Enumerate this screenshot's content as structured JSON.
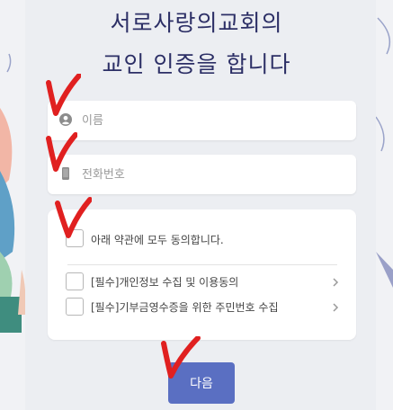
{
  "page": {
    "title_line1": "서로사랑의교회의",
    "title_line2": "교인 인증을 합니다"
  },
  "form": {
    "name": {
      "placeholder": "이름",
      "icon": "person-icon"
    },
    "phone": {
      "placeholder": "전화번호",
      "icon": "phone-icon"
    }
  },
  "agreements": {
    "all_label": "아래 약관에 모두 동의합니다.",
    "items": [
      {
        "label": "[필수]개인정보 수집 및 이용동의"
      },
      {
        "label": "[필수]기부금영수증을 위한 주민번호 수집"
      }
    ]
  },
  "actions": {
    "next_label": "다음"
  },
  "colors": {
    "title": "#2c2f66",
    "button": "#5a6fc2",
    "annotation": "#e02020"
  }
}
